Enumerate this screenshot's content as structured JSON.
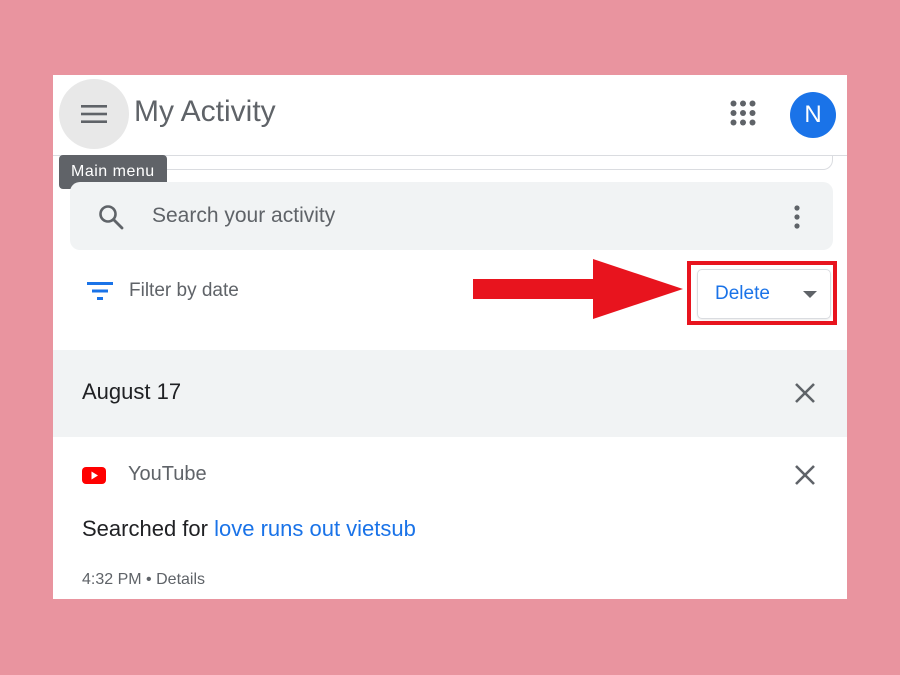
{
  "header": {
    "title": "My Activity",
    "avatar_initial": "N",
    "menu_tooltip": "Main menu"
  },
  "search": {
    "placeholder": "Search your activity"
  },
  "filter": {
    "label": "Filter by date"
  },
  "delete_button": {
    "label": "Delete"
  },
  "activity": {
    "date": "August 17",
    "items": [
      {
        "source": "YouTube",
        "action": "Searched for",
        "query": "love runs out vietsub",
        "time": "4:32 PM",
        "details": "Details"
      }
    ]
  },
  "colors": {
    "background": "#e9949f",
    "accent": "#1a73e8",
    "highlight": "#e8141e",
    "youtube": "#ff0000"
  },
  "icons": [
    "menu-icon",
    "apps-grid-icon",
    "search-icon",
    "more-vert-icon",
    "filter-icon",
    "dropdown-caret-icon",
    "close-icon",
    "youtube-icon",
    "red-arrow-annotation"
  ]
}
